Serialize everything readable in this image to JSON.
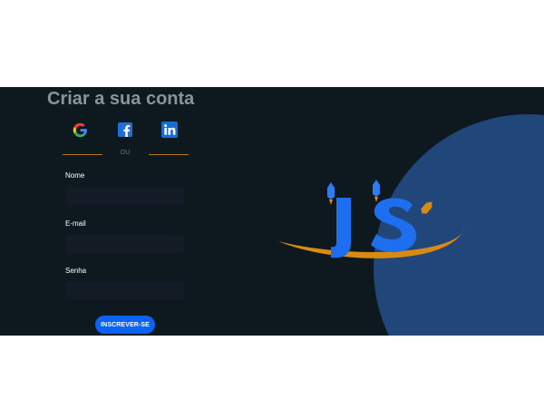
{
  "signup": {
    "title": "Criar a sua conta",
    "social_buttons": [
      {
        "name": "google-icon"
      },
      {
        "name": "facebook-icon"
      },
      {
        "name": "linkedin-icon"
      }
    ],
    "divider_text": "OU",
    "fields": {
      "name_label": "Nome",
      "name_value": "",
      "email_label": "E-mail",
      "email_value": "",
      "password_label": "Senha",
      "password_value": ""
    },
    "submit_label": "INSCREVER-SE"
  },
  "colors": {
    "background": "#0d181f",
    "planet": "#21467a",
    "accent_orange": "#d98a12",
    "button_blue": "#0b63f6",
    "logo_blue": "#1e6ff0"
  },
  "logo": {
    "letters": "JS"
  }
}
